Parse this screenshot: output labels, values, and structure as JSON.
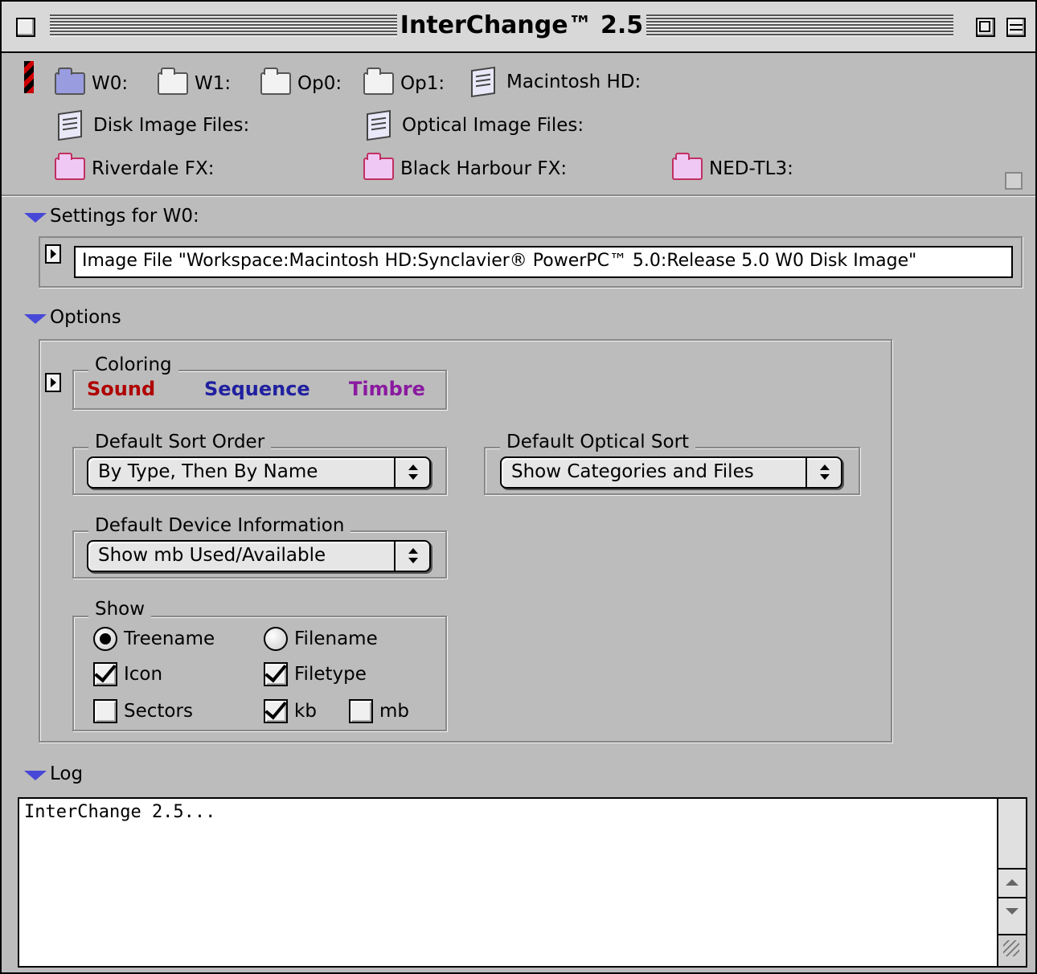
{
  "window": {
    "title": "InterChange™ 2.5"
  },
  "volumes": {
    "row1": [
      {
        "label": "W0:",
        "icon": "folder-icon",
        "color": "#9a9ce0"
      },
      {
        "label": "W1:",
        "icon": "folder-icon",
        "color": "#f2f2f2"
      },
      {
        "label": "Op0:",
        "icon": "folder-icon",
        "color": "#f2f2f2"
      },
      {
        "label": "Op1:",
        "icon": "folder-icon",
        "color": "#f2f2f2"
      },
      {
        "label": "Macintosh HD:",
        "icon": "disk-icon"
      }
    ],
    "row2": [
      {
        "label": "Disk Image Files:",
        "icon": "disk-icon"
      },
      {
        "label": "Optical Image Files:",
        "icon": "disk-icon"
      }
    ],
    "row3": [
      {
        "label": "Riverdale FX:",
        "icon": "folder-icon",
        "color": "#f0c8f4"
      },
      {
        "label": "Black Harbour FX:",
        "icon": "folder-icon",
        "color": "#f0c8f4"
      },
      {
        "label": "NED-TL3:",
        "icon": "folder-icon",
        "color": "#f0c8f4"
      }
    ]
  },
  "settings": {
    "header": "Settings for W0:",
    "path": "Image File \"Workspace:Macintosh HD:Synclavier® PowerPC™ 5.0:Release 5.0 W0 Disk Image\""
  },
  "options": {
    "header": "Options",
    "coloring": {
      "label": "Coloring",
      "items": [
        {
          "label": "Sound",
          "color": "#b00000"
        },
        {
          "label": "Sequence",
          "color": "#2020a0"
        },
        {
          "label": "Timbre",
          "color": "#8a1aa0"
        }
      ]
    },
    "sort_order": {
      "label": "Default Sort Order",
      "value": "By Type, Then By Name"
    },
    "optical_sort": {
      "label": "Default Optical Sort",
      "value": "Show Categories and Files"
    },
    "device_info": {
      "label": "Default Device Information",
      "value": "Show mb Used/Available"
    },
    "show": {
      "label": "Show",
      "treename": {
        "label": "Treename",
        "selected": true
      },
      "filename": {
        "label": "Filename",
        "selected": false
      },
      "icon": {
        "label": "Icon",
        "checked": true
      },
      "filetype": {
        "label": "Filetype",
        "checked": true
      },
      "sectors": {
        "label": "Sectors",
        "checked": false
      },
      "kb": {
        "label": "kb",
        "checked": true
      },
      "mb": {
        "label": "mb",
        "checked": false
      }
    }
  },
  "log": {
    "header": "Log",
    "text": "InterChange 2.5..."
  }
}
